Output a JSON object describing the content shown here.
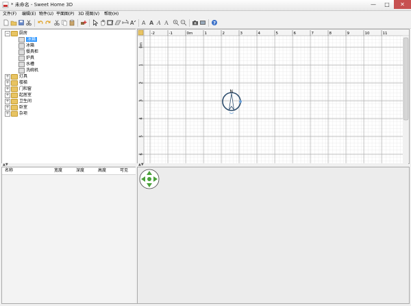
{
  "window": {
    "title": "* 未命名 - Sweet Home 3D",
    "min_glyph": "—",
    "max_glyph": "□",
    "close_glyph": "✕"
  },
  "menu": {
    "items": [
      {
        "label": "文件(F)"
      },
      {
        "label": "编辑(E)"
      },
      {
        "label": "物件(U)"
      },
      {
        "label": "平面图(P)"
      },
      {
        "label": "3D 视图(V)"
      },
      {
        "label": "帮助(H)"
      }
    ]
  },
  "toolbar": {
    "icons": [
      "new-icon",
      "open-icon",
      "save-icon",
      "cut-icon",
      "undo-icon",
      "redo-icon",
      "cut2-icon",
      "copy-icon",
      "paste-icon",
      "add-furniture-icon",
      "select-icon",
      "pan-icon",
      "create-walls-icon",
      "create-rooms-icon",
      "create-dimensions-icon",
      "create-labels-icon",
      "text-size-icon",
      "text-bold-icon",
      "text-italic-icon",
      "text-style-icon",
      "zoom-in-icon",
      "zoom-out-icon",
      "photo-icon",
      "video-icon",
      "help-icon"
    ]
  },
  "catalog": {
    "categories": [
      {
        "label": "厨房",
        "expanded": true,
        "children": [
          {
            "label": "冰箱",
            "selected": true
          },
          {
            "label": "冰箱"
          },
          {
            "label": "餐具柜"
          },
          {
            "label": "炉具"
          },
          {
            "label": "水槽"
          },
          {
            "label": "洗碗机"
          }
        ]
      },
      {
        "label": "灯具"
      },
      {
        "label": "楼梯"
      },
      {
        "label": "门和窗"
      },
      {
        "label": "起居室"
      },
      {
        "label": "卫生间"
      },
      {
        "label": "卧室"
      },
      {
        "label": "杂项"
      }
    ],
    "expand_glyph": "+",
    "collapse_glyph": "−"
  },
  "splitter": {
    "arrows": "▲▼"
  },
  "furniture_table": {
    "columns": [
      "名称",
      "宽度",
      "深度",
      "高度",
      "可见"
    ]
  },
  "plan": {
    "ruler_x_labels": [
      "-2",
      "-1",
      "0m",
      "1",
      "2",
      "3",
      "4",
      "5",
      "6",
      "7",
      "8",
      "9",
      "10",
      "11"
    ],
    "ruler_y_labels": [
      "0m",
      "1",
      "2",
      "3",
      "4",
      "5",
      "6"
    ],
    "compass_label": "N"
  }
}
